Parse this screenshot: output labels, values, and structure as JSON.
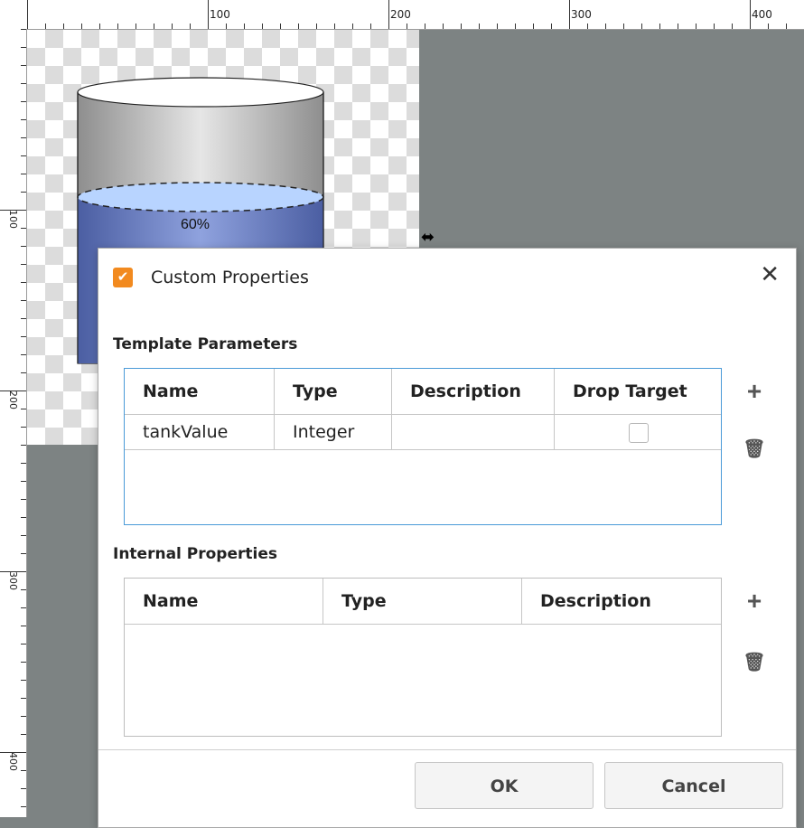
{
  "rulers": {
    "top_labels": [
      "100",
      "200",
      "300",
      "400"
    ],
    "left_labels": [
      "100",
      "200",
      "300",
      "400"
    ]
  },
  "tank": {
    "value_label": "60%",
    "fill_fraction": 0.6,
    "colors": {
      "shell": "#b8b8b8",
      "liquid": "#5f73b5",
      "liquid_top": "#b8d4ff"
    }
  },
  "dialog": {
    "title": "Custom Properties",
    "app_icon": "ignition-app-icon",
    "close_icon": "close-icon",
    "template_parameters": {
      "section_title": "Template Parameters",
      "columns": [
        "Name",
        "Type",
        "Description",
        "Drop Target"
      ],
      "rows": [
        {
          "name": "tankValue",
          "type": "Integer",
          "description": "",
          "drop_target": false
        }
      ]
    },
    "internal_properties": {
      "section_title": "Internal Properties",
      "columns": [
        "Name",
        "Type",
        "Description"
      ],
      "rows": []
    },
    "buttons": {
      "ok": "OK",
      "cancel": "Cancel"
    },
    "icons": {
      "add": "plus-icon",
      "delete": "trash-icon"
    }
  }
}
